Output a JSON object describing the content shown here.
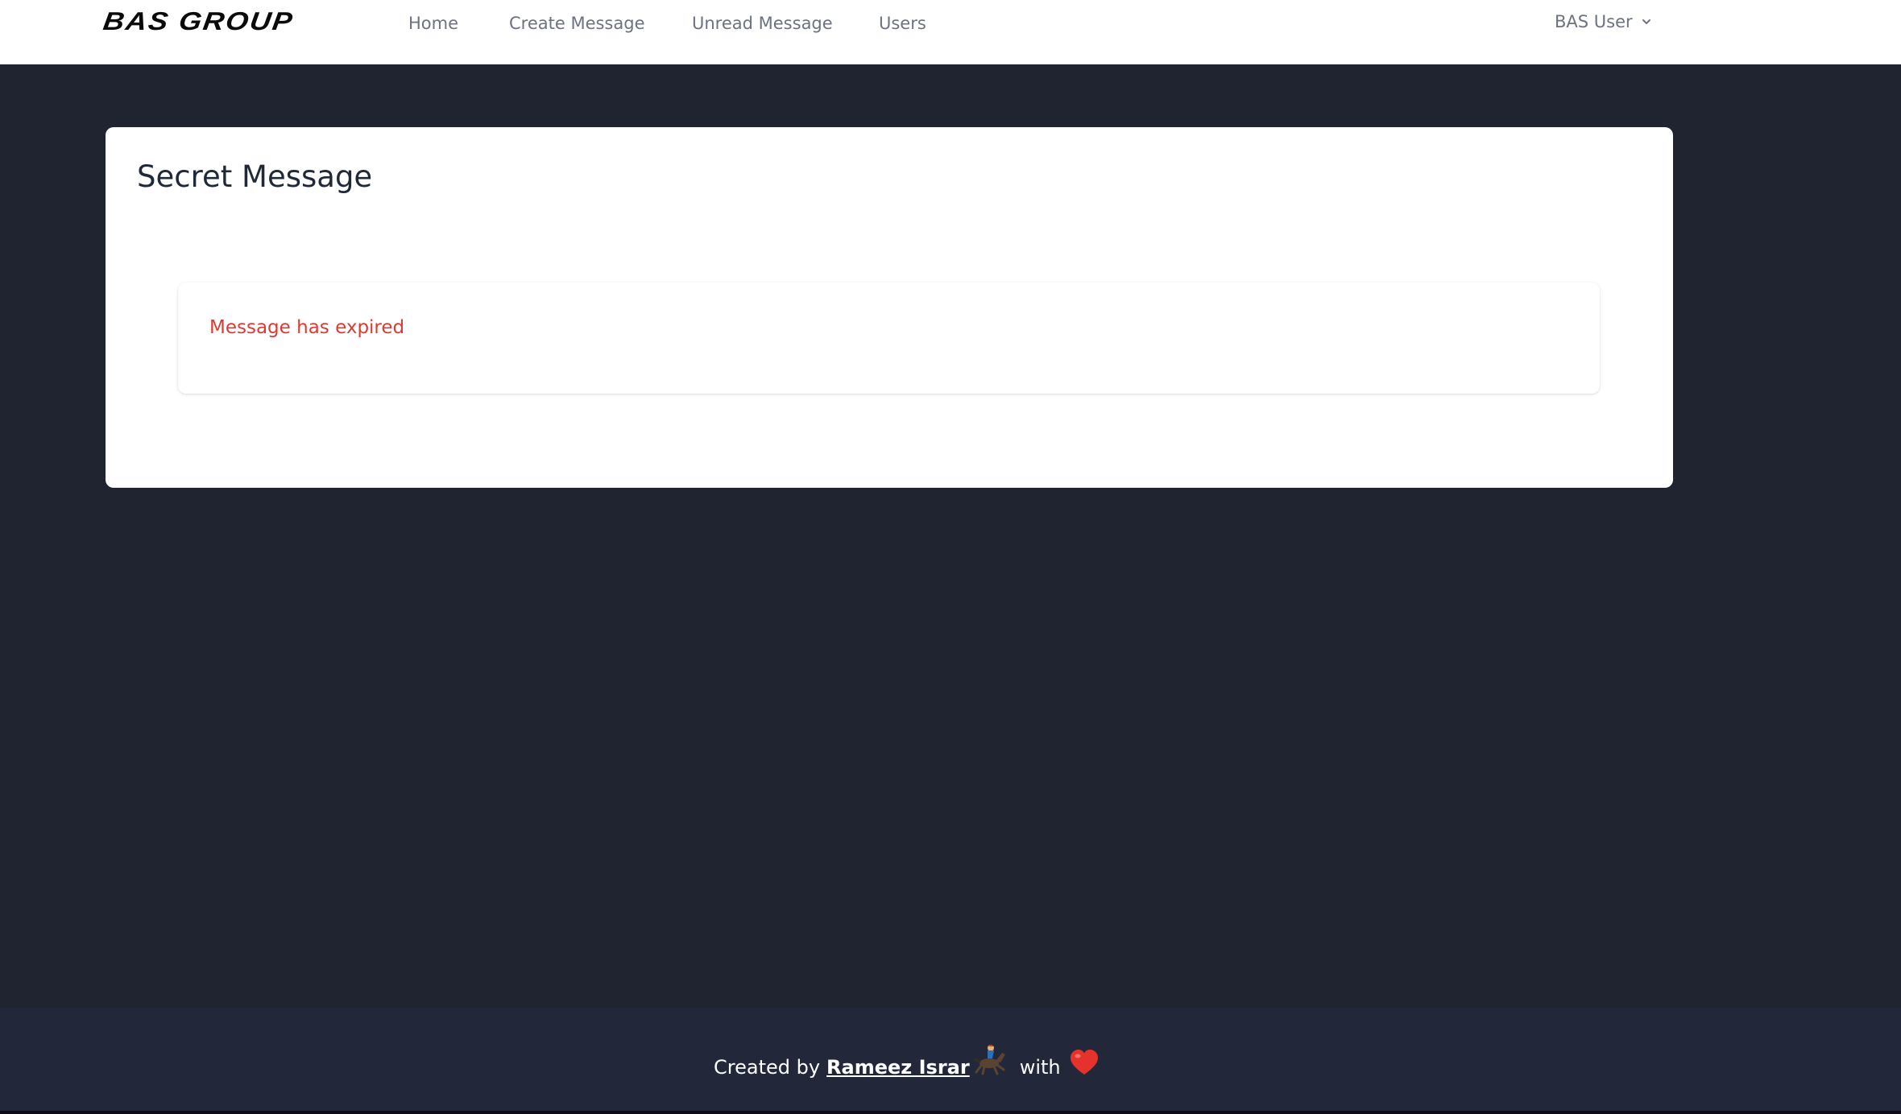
{
  "header": {
    "logo_text": "BAS GROUP",
    "nav": {
      "home": "Home",
      "create_message": "Create Message",
      "unread_message": "Unread Message",
      "users": "Users"
    },
    "user_menu": {
      "label": "BAS User",
      "icon": "chevron-down-icon"
    }
  },
  "main": {
    "title": "Secret Message",
    "alert": {
      "text": "Message has expired",
      "color": "#dc3b34"
    }
  },
  "footer": {
    "prefix": "Created by",
    "author": "Rameez Israr",
    "with_text": "with",
    "icons": [
      "jockey-icon",
      "heart-icon"
    ]
  },
  "colors": {
    "page_background": "#1f2430",
    "footer_background": "#222839",
    "nav_text": "#6b7280",
    "card_background": "#ffffff"
  }
}
